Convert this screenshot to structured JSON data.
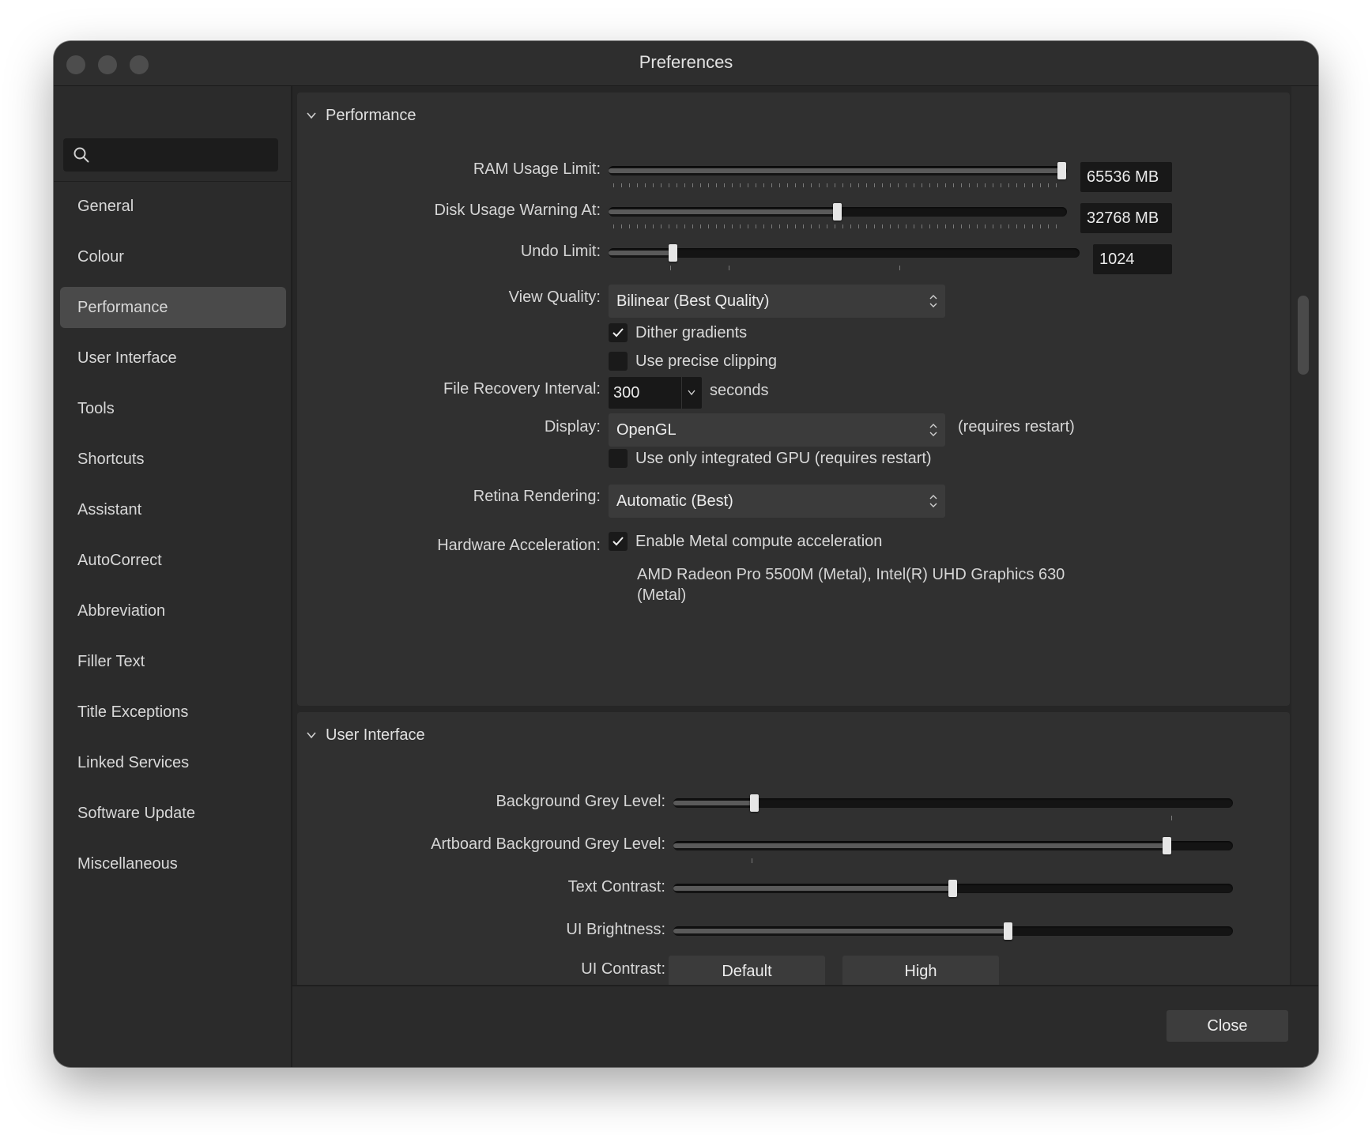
{
  "window": {
    "title": "Preferences"
  },
  "sidebar": {
    "search_placeholder": "",
    "items": [
      {
        "label": "General"
      },
      {
        "label": "Colour"
      },
      {
        "label": "Performance",
        "active": true
      },
      {
        "label": "User Interface"
      },
      {
        "label": "Tools"
      },
      {
        "label": "Shortcuts"
      },
      {
        "label": "Assistant"
      },
      {
        "label": "AutoCorrect"
      },
      {
        "label": "Abbreviation"
      },
      {
        "label": "Filler Text"
      },
      {
        "label": "Title Exceptions"
      },
      {
        "label": "Linked Services"
      },
      {
        "label": "Software Update"
      },
      {
        "label": "Miscellaneous"
      }
    ]
  },
  "performance": {
    "heading": "Performance",
    "ram": {
      "label": "RAM Usage Limit:",
      "value": "65536 MB",
      "level": 1.0
    },
    "disk": {
      "label": "Disk Usage Warning At:",
      "value": "32768 MB",
      "level": 0.5
    },
    "undo": {
      "label": "Undo Limit:",
      "value": "1024",
      "level": 0.13
    },
    "view_quality": {
      "label": "View Quality:",
      "value": "Bilinear (Best Quality)"
    },
    "dither": {
      "label": "Dither gradients",
      "checked": true
    },
    "precise_clipping": {
      "label": "Use precise clipping",
      "checked": false
    },
    "file_recovery": {
      "label": "File Recovery Interval:",
      "value": "300",
      "unit": "seconds"
    },
    "display": {
      "label": "Display:",
      "value": "OpenGL",
      "note": "(requires restart)"
    },
    "integrated_gpu": {
      "label": "Use only integrated GPU (requires restart)",
      "checked": false
    },
    "retina": {
      "label": "Retina Rendering:",
      "value": "Automatic (Best)"
    },
    "hardware": {
      "label": "Hardware Acceleration:",
      "metal_label": "Enable Metal compute acceleration",
      "metal_checked": true,
      "gpu_line1": "AMD Radeon Pro 5500M (Metal), Intel(R) UHD Graphics 630",
      "gpu_line2": "(Metal)"
    }
  },
  "user_interface": {
    "heading": "User Interface",
    "bg_grey": {
      "label": "Background Grey Level:",
      "level": 0.14
    },
    "artboard_grey": {
      "label": "Artboard Background Grey Level:",
      "level": 0.89
    },
    "text_contrast": {
      "label": "Text Contrast:",
      "level": 0.5
    },
    "ui_brightness": {
      "label": "UI Brightness:",
      "level": 0.6
    },
    "ui_contrast": {
      "label": "UI Contrast:",
      "default_label": "Default",
      "high_label": "High"
    }
  },
  "footer": {
    "close_label": "Close"
  },
  "colors": {
    "window_bg": "#2b2b2b",
    "panel_bg": "#303030",
    "active_nav": "#4a4a4a",
    "field_bg": "#181818"
  }
}
